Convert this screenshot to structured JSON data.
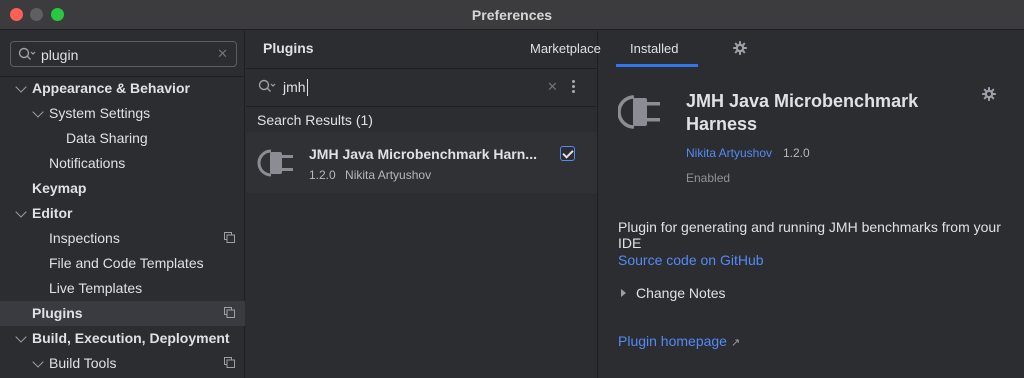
{
  "window": {
    "title": "Preferences"
  },
  "sidebar": {
    "search_value": "plugin",
    "items": [
      {
        "label": "Appearance & Behavior"
      },
      {
        "label": "System Settings"
      },
      {
        "label": "Data Sharing"
      },
      {
        "label": "Notifications"
      },
      {
        "label": "Keymap"
      },
      {
        "label": "Editor"
      },
      {
        "label": "Inspections"
      },
      {
        "label": "File and Code Templates"
      },
      {
        "label": "Live Templates"
      },
      {
        "label": "Plugins"
      },
      {
        "label": "Build, Execution, Deployment"
      },
      {
        "label": "Build Tools"
      }
    ]
  },
  "plugins": {
    "title": "Plugins",
    "tabs": [
      {
        "label": "Marketplace"
      },
      {
        "label": "Installed"
      }
    ],
    "active_tab": "Installed",
    "search_query": "jmh",
    "results_header": "Search Results (1)",
    "results": [
      {
        "name": "JMH Java Microbenchmark Harn...",
        "version": "1.2.0",
        "vendor": "Nikita Artyushov",
        "enabled": true
      }
    ]
  },
  "details": {
    "title": "JMH Java Microbenchmark Harness",
    "vendor": "Nikita Artyushov",
    "version": "1.2.0",
    "status": "Enabled",
    "description": "Plugin for generating and running JMH benchmarks from your IDE",
    "source_link": "Source code on GitHub",
    "change_notes": "Change Notes",
    "homepage_link": "Plugin homepage"
  },
  "colors": {
    "accent": "#3574f0",
    "link": "#548af7",
    "background": "#2b2d30",
    "selection": "#393b40"
  }
}
